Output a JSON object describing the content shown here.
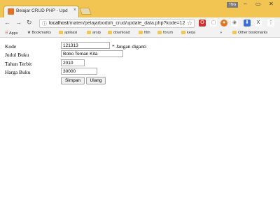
{
  "browser": {
    "tab_title": "Belajar CRUD PHP - Upd",
    "tab_close": "×",
    "user_badge": "ТNG",
    "url_prefix": "localhost",
    "url_rest": "/materi/pelajarbodoh_crud/update_data.php?kode=12",
    "bookmarks": [
      "Apps",
      "Bookmarks",
      "aplikasi",
      "arsip",
      "download",
      "film",
      "forum",
      "kerja"
    ],
    "more_bookmarks": "»",
    "other_bookmarks": "Other bookmarks"
  },
  "form": {
    "fields": [
      {
        "label": "Kode",
        "value": "121313",
        "note": "* Jangan diganti"
      },
      {
        "label": "Judul Buku",
        "value": "Bobo Teman Kita"
      },
      {
        "label": "Tahun Terbit",
        "value": "2010"
      },
      {
        "label": "Harga Buku",
        "value": "30000"
      }
    ],
    "submit_label": "Simpan",
    "reset_label": "Ulang"
  }
}
